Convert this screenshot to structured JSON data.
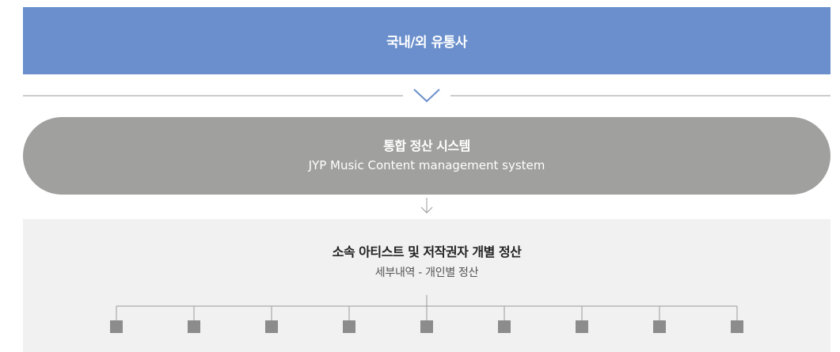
{
  "top_banner": {
    "label": "국내/외 유통사"
  },
  "system_box": {
    "title": "통합 정산 시스템",
    "subtitle": "JYP Music Content management system"
  },
  "settlement_panel": {
    "title": "소속 아티스트 및 저작권자 개별 정산",
    "subtitle": "세부내역 - 개인별 정산",
    "leaf_count": 9
  },
  "colors": {
    "banner": "#6a8fcc",
    "system_box": "#a0a09f",
    "panel_bg": "#f1f1f1",
    "leaf": "#8c8c8c",
    "connector": "#9a9a9a"
  }
}
